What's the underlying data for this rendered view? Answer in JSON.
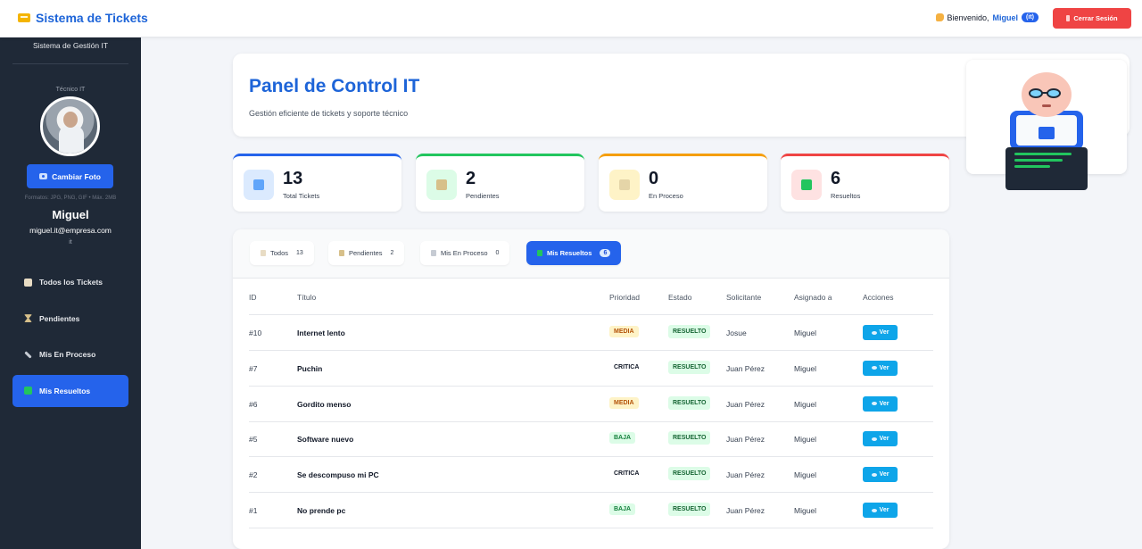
{
  "header": {
    "app_title": "Sistema de Tickets",
    "welcome_text": "Bienvenido,",
    "username": "Miguel",
    "user_badge": "(it)",
    "logout_label": "Cerrar Sesión"
  },
  "sidebar": {
    "subtitle": "Sistema de Gestión IT",
    "role": "Técnico IT",
    "change_photo_label": "Cambiar Foto",
    "formats_note": "Formatos: JPG, PNG, GIF • Máx. 2MB",
    "name": "Miguel",
    "email": "miguel.it@empresa.com",
    "department": "it",
    "nav": [
      {
        "label": "Todos los Tickets",
        "icon": "clipboard-icon"
      },
      {
        "label": "Pendientes",
        "icon": "hourglass-icon"
      },
      {
        "label": "Mis En Proceso",
        "icon": "wrench-icon"
      },
      {
        "label": "Mis Resueltos",
        "icon": "check-icon",
        "active": true
      }
    ]
  },
  "hero": {
    "title": "Panel de Control IT",
    "subtitle": "Gestión eficiente de tickets y soporte técnico"
  },
  "stats": [
    {
      "value": "13",
      "label": "Total Tickets",
      "icon": "chart-icon",
      "accent": "#2563eb",
      "bg": "#dbeafe",
      "glyph": "#60a5fa"
    },
    {
      "value": "2",
      "label": "Pendientes",
      "icon": "hourglass-icon",
      "accent": "#22c55e",
      "bg": "#dcfce7",
      "glyph": "#d7c08a"
    },
    {
      "value": "0",
      "label": "En Proceso",
      "icon": "wrench-icon",
      "accent": "#f59e0b",
      "bg": "#fef3c7",
      "glyph": "#e5d5a8"
    },
    {
      "value": "6",
      "label": "Resueltos",
      "icon": "check-icon",
      "accent": "#ef4444",
      "bg": "#fee2e2",
      "glyph": "#22c55e"
    }
  ],
  "tabs": [
    {
      "label": "Todos",
      "count": "13",
      "icon": "clipboard-icon"
    },
    {
      "label": "Pendientes",
      "count": "2",
      "icon": "hourglass-icon"
    },
    {
      "label": "Mis En Proceso",
      "count": "0",
      "icon": "wrench-icon"
    },
    {
      "label": "Mis Resueltos",
      "count": "6",
      "icon": "check-icon",
      "active": true
    }
  ],
  "table": {
    "columns": [
      "ID",
      "Título",
      "Prioridad",
      "Estado",
      "Solicitante",
      "Asignado a",
      "Acciones"
    ],
    "action_label": "Ver",
    "rows": [
      {
        "id": "#10",
        "title": "Internet lento",
        "priority": "MEDIA",
        "status": "RESUELTO",
        "requester": "Josue",
        "assignee": "Miguel"
      },
      {
        "id": "#7",
        "title": "Puchin",
        "priority": "CRITICA",
        "status": "RESUELTO",
        "requester": "Juan Pérez",
        "assignee": "Miguel"
      },
      {
        "id": "#6",
        "title": "Gordito menso",
        "priority": "MEDIA",
        "status": "RESUELTO",
        "requester": "Juan Pérez",
        "assignee": "Miguel"
      },
      {
        "id": "#5",
        "title": "Software nuevo",
        "priority": "BAJA",
        "status": "RESUELTO",
        "requester": "Juan Pérez",
        "assignee": "Miguel"
      },
      {
        "id": "#2",
        "title": "Se descompuso mi PC",
        "priority": "CRITICA",
        "status": "RESUELTO",
        "requester": "Juan Pérez",
        "assignee": "Miguel"
      },
      {
        "id": "#1",
        "title": "No prende pc",
        "priority": "BAJA",
        "status": "RESUELTO",
        "requester": "Juan Pérez",
        "assignee": "Miguel"
      }
    ]
  },
  "colors": {
    "primary": "#2563eb",
    "sidebar": "#1f2937",
    "danger": "#ef4444",
    "action": "#0ea5e9"
  }
}
